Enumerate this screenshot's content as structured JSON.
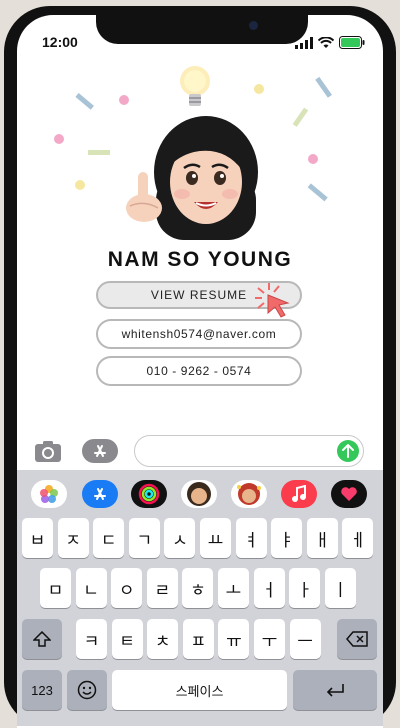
{
  "status_bar": {
    "time": "12:00"
  },
  "profile": {
    "name": "NAM SO YOUNG",
    "resume_button": "VIEW RESUME",
    "email": "whitensh0574@naver.com",
    "phone": "010 - 9262 - 0574"
  },
  "message_bar": {
    "placeholder": ""
  },
  "keyboard": {
    "row1": [
      "ㅂ",
      "ㅈ",
      "ㄷ",
      "ㄱ",
      "ㅅ",
      "ㅛ",
      "ㅕ",
      "ㅑ",
      "ㅐ",
      "ㅔ"
    ],
    "row2": [
      "ㅁ",
      "ㄴ",
      "ㅇ",
      "ㄹ",
      "ㅎ",
      "ㅗ",
      "ㅓ",
      "ㅏ",
      "ㅣ"
    ],
    "row3": [
      "ㅋ",
      "ㅌ",
      "ㅊ",
      "ㅍ",
      "ㅠ",
      "ㅜ",
      "ㅡ"
    ],
    "numbers_key": "123",
    "space_key": "스페이스"
  },
  "colors": {
    "send": "#34c759",
    "battery": "#34c759",
    "keyboard_bg": "#d1d3d9"
  }
}
